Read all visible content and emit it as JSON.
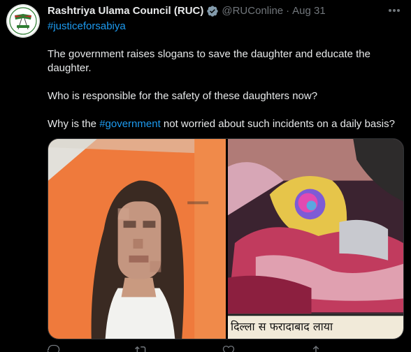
{
  "account": {
    "display_name": "Rashtriya Ulama Council (RUC)",
    "handle": "@RUConline",
    "separator": "·",
    "date": "Aug 31",
    "avatar_icon": "ruc-logo-icon",
    "verified_icon": "verified-badge-icon"
  },
  "tweet": {
    "hashtag": "#justiceforsabiya",
    "paragraph1": "The government raises slogans to save the daughter and educate the daughter.",
    "paragraph2": "Who is responsible for the safety of these daughters now?",
    "paragraph3_prefix": "Why is the ",
    "paragraph3_hashtag": "#government",
    "paragraph3_suffix": " not worried about such incidents on a daily basis?"
  },
  "media": {
    "right_caption": "दिल्ला स फरादाबाद लाया"
  },
  "actions": [
    {
      "icon": "reply-icon",
      "count": ""
    },
    {
      "icon": "retweet-icon",
      "count": ""
    },
    {
      "icon": "like-icon",
      "count": ""
    },
    {
      "icon": "share-icon",
      "count": ""
    }
  ],
  "colors": {
    "background": "#000000",
    "text": "#e7e9ea",
    "muted": "#71767b",
    "link": "#1d9bf0",
    "border": "#2f3336"
  }
}
